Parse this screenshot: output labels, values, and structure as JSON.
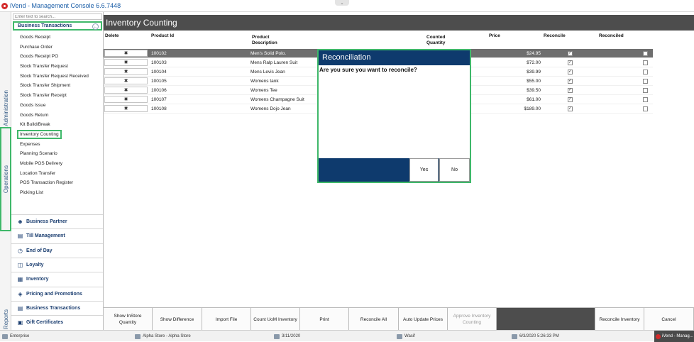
{
  "window": {
    "title": "iVend - Management Console  6.6.7448"
  },
  "sidebar": {
    "search_placeholder": "Enter text to search...",
    "section_title": "Business Transactions",
    "items": [
      "Goods Receipt",
      "Purchase Order",
      "Goods Receipt PO",
      "Stock Transfer Request",
      "Stock Transfer Request Received",
      "Stock Transfer Shipment",
      "Stock Transfer Receipt",
      "Goods Issue",
      "Goods Return",
      "Kit Build/Break",
      "Inventory Counting",
      "Expenses",
      "Planning Scenario",
      "Mobile POS Delivery",
      "Location Transfer",
      "POS Transaction Register",
      "Picking List"
    ],
    "selected_item": "Inventory Counting",
    "nav_sections": [
      "Business Partner",
      "Till Management",
      "End of Day",
      "Loyalty",
      "Inventory",
      "Pricing and Promotions",
      "Business Transactions",
      "Gift Certificates"
    ]
  },
  "vertical_tabs": {
    "administration": "Administration",
    "operations": "Operations",
    "reports": "Reports"
  },
  "page": {
    "title": "Inventory Counting"
  },
  "grid": {
    "headers": {
      "delete": "Delete",
      "product_id": "Product Id",
      "product_desc": "Product Description",
      "counted_qty": "Counted Quantity",
      "price": "Price",
      "reconcile": "Reconcile",
      "reconciled": "Reconciled"
    },
    "rows": [
      {
        "id": "100102",
        "desc": "Men's Solid Polo.",
        "price": "$24.95",
        "reconcile": true,
        "reconciled": false
      },
      {
        "id": "100103",
        "desc": "Mens Ralp Lauren Suit",
        "price": "$72.00",
        "reconcile": true,
        "reconciled": false
      },
      {
        "id": "100104",
        "desc": "Mens Levis Jean",
        "price": "$39.99",
        "reconcile": true,
        "reconciled": false
      },
      {
        "id": "100105",
        "desc": "Womens tank",
        "price": "$55.00",
        "reconcile": true,
        "reconciled": false
      },
      {
        "id": "100106",
        "desc": "Womens Tee",
        "price": "$39.50",
        "reconcile": true,
        "reconciled": false
      },
      {
        "id": "100107",
        "desc": "Womens Champagne Suit",
        "price": "$61.00",
        "reconcile": true,
        "reconciled": false
      },
      {
        "id": "100108",
        "desc": "Womens Dojo Jean",
        "price": "$189.00",
        "reconcile": true,
        "reconciled": false
      }
    ]
  },
  "dialog": {
    "title": "Reconciliation",
    "message": "Are you sure you want to reconcile?",
    "yes": "Yes",
    "no": "No"
  },
  "toolbar": {
    "show_instore": "Show InStore Quantity",
    "show_difference": "Show Difference",
    "import_file": "Import File",
    "count_uom": "Count UoM Inventory",
    "print": "Print",
    "reconcile_all": "Reconcile All",
    "auto_update": "Auto Update Prices",
    "approve": "Approve Inventory Counting",
    "reconcile_inventory": "Reconcile Inventory",
    "cancel": "Cancel"
  },
  "statusbar": {
    "edition": "Enterprise",
    "store": "Alpha Store - Alpha Store",
    "date": "3/11/2020",
    "user": "Wasif",
    "datetime": "6/3/2020 5:26:33 PM",
    "taskbar": "iVend - Manag..."
  },
  "colors": {
    "accent_green": "#3fb86a",
    "navy": "#0e3a6d",
    "header_gray": "#4d4d4d"
  }
}
